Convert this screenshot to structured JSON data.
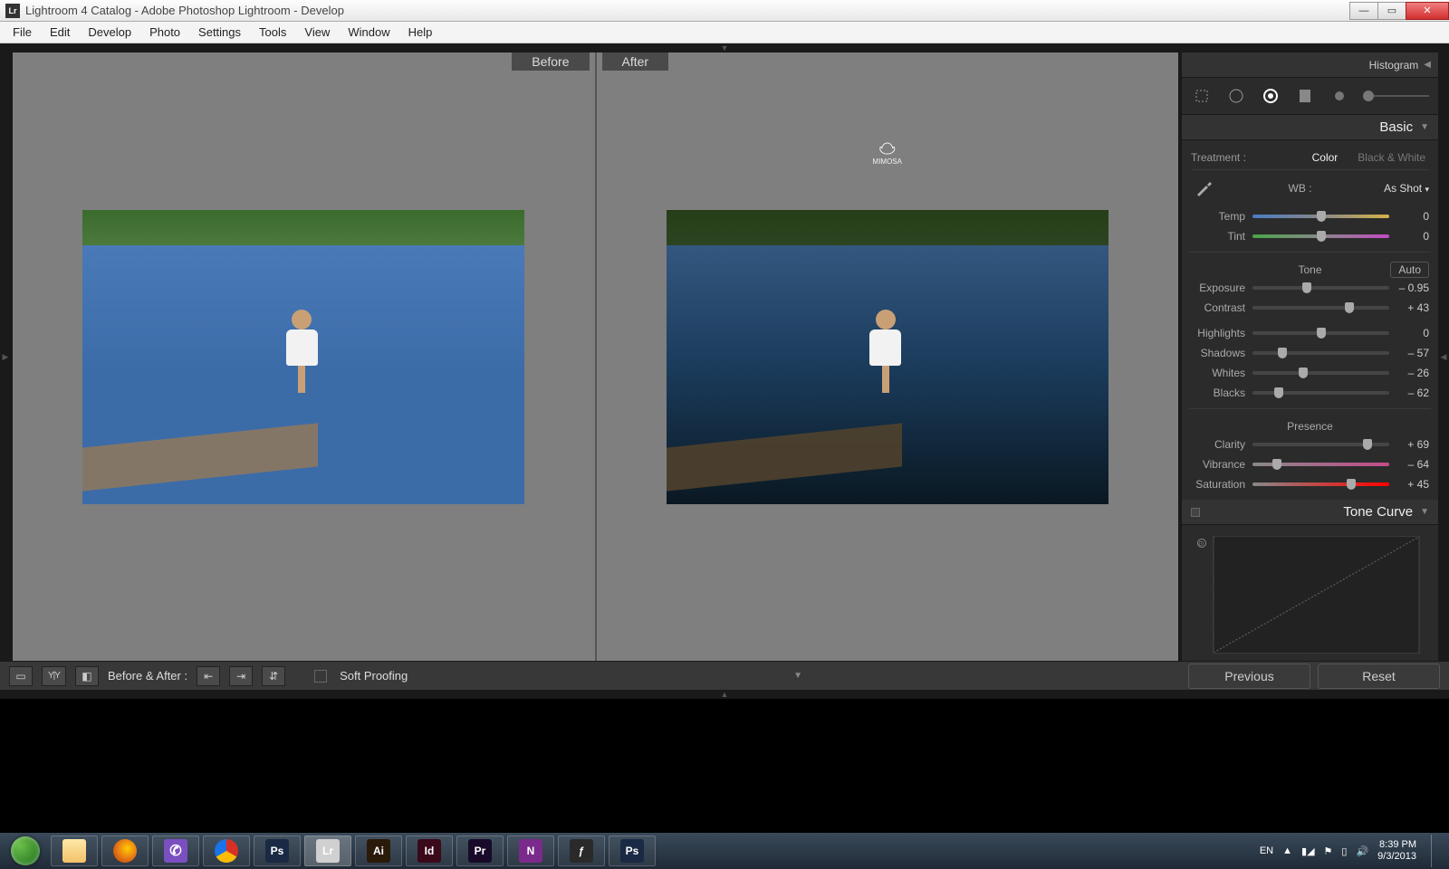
{
  "titlebar": {
    "text": "Lightroom 4 Catalog - Adobe Photoshop Lightroom - Develop",
    "lr_badge": "Lr"
  },
  "menubar": [
    "File",
    "Edit",
    "Develop",
    "Photo",
    "Settings",
    "Tools",
    "View",
    "Window",
    "Help"
  ],
  "preview": {
    "before_label": "Before",
    "after_label": "After",
    "watermark": "MIMOSA"
  },
  "right": {
    "histogram": "Histogram",
    "basic_title": "Basic",
    "treatment_label": "Treatment :",
    "treatment_color": "Color",
    "treatment_bw": "Black & White",
    "wb_label": "WB :",
    "wb_value": "As Shot",
    "tone_label": "Tone",
    "auto_label": "Auto",
    "presence_label": "Presence",
    "tonecurve_title": "Tone Curve",
    "sliders_wb": [
      {
        "name": "Temp",
        "value": "0",
        "pos": 50
      },
      {
        "name": "Tint",
        "value": "0",
        "pos": 50
      }
    ],
    "sliders_tone": [
      {
        "name": "Exposure",
        "value": "– 0.95",
        "pos": 40
      },
      {
        "name": "Contrast",
        "value": "+ 43",
        "pos": 71
      }
    ],
    "sliders_light": [
      {
        "name": "Highlights",
        "value": "0",
        "pos": 50
      },
      {
        "name": "Shadows",
        "value": "– 57",
        "pos": 22
      },
      {
        "name": "Whites",
        "value": "– 26",
        "pos": 37
      },
      {
        "name": "Blacks",
        "value": "– 62",
        "pos": 19
      }
    ],
    "sliders_presence": [
      {
        "name": "Clarity",
        "value": "+ 69",
        "pos": 84
      },
      {
        "name": "Vibrance",
        "value": "– 64",
        "pos": 18
      },
      {
        "name": "Saturation",
        "value": "+ 45",
        "pos": 72
      }
    ]
  },
  "bottombar": {
    "before_after": "Before & After :",
    "softproof": "Soft Proofing",
    "previous": "Previous",
    "reset": "Reset"
  },
  "taskbar": {
    "lang": "EN",
    "time": "8:39 PM",
    "date": "9/3/2013",
    "apps": [
      {
        "name": "explorer",
        "bg": "#f3c268"
      },
      {
        "name": "firefox",
        "bg": "#e77817"
      },
      {
        "name": "viber",
        "bg": "#7a4fc0"
      },
      {
        "name": "chrome",
        "bg": "#2aa844"
      },
      {
        "name": "photoshop",
        "bg": "#1a2a44"
      },
      {
        "name": "lightroom",
        "bg": "#d0d0d0",
        "active": true
      },
      {
        "name": "illustrator",
        "bg": "#2a1a0a"
      },
      {
        "name": "indesign",
        "bg": "#3a0a1a"
      },
      {
        "name": "premiere",
        "bg": "#1a0a2a"
      },
      {
        "name": "onenote",
        "bg": "#7a2a8a"
      },
      {
        "name": "flash",
        "bg": "#2a2a2a"
      },
      {
        "name": "photoshop2",
        "bg": "#1a2a44"
      }
    ]
  }
}
